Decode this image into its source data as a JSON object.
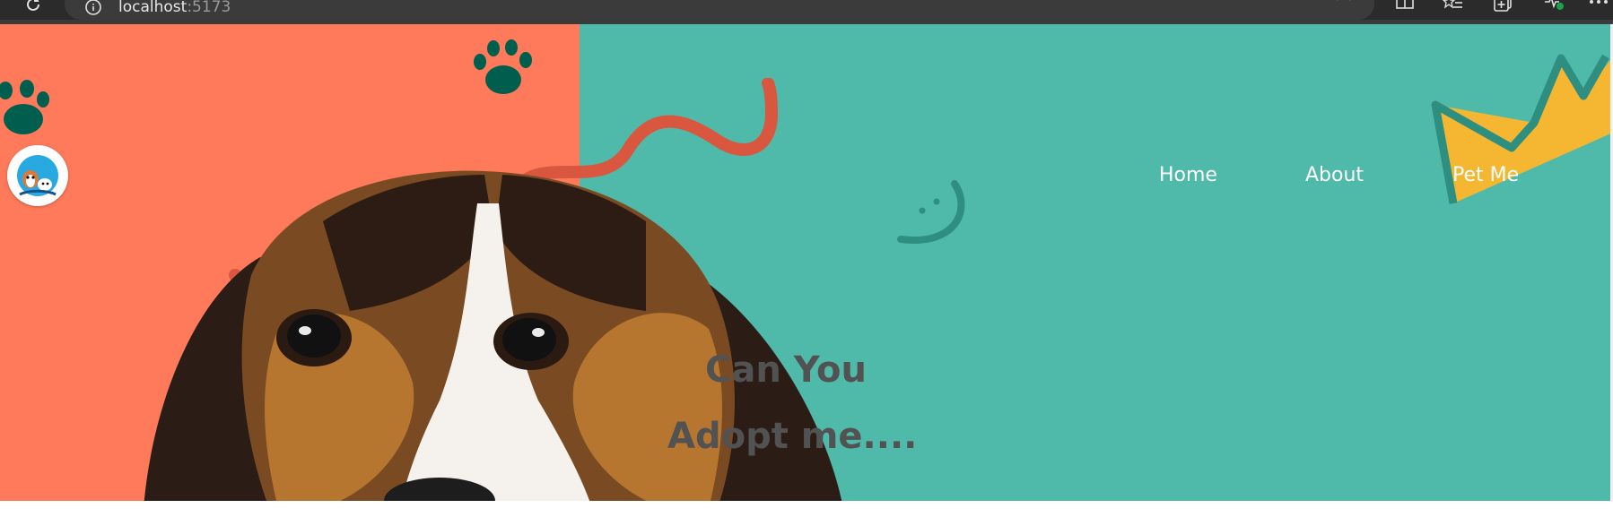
{
  "browser": {
    "url_host": "localhost",
    "url_port": ":5173"
  },
  "nav": {
    "home": "Home",
    "about": "About",
    "pet_me": "Pet Me"
  },
  "hero": {
    "headline_line1": "Can You",
    "headline_line2": "Adopt me....",
    "image": "beagle-puppy-photo"
  },
  "colors": {
    "left_panel": "#ff7a5a",
    "right_panel": "#4fbaa9",
    "paw": "#005e4f",
    "squiggle": "#d9573f",
    "crown": "#f5b731",
    "headline": "#525252"
  },
  "icons": [
    "reload-icon",
    "info-icon",
    "zoom-out-icon",
    "read-aloud-icon",
    "favorite-star-icon",
    "split-screen-icon",
    "favorites-list-icon",
    "collections-icon",
    "browser-health-icon",
    "more-icon",
    "paw-icon",
    "smiley-icon",
    "crown-icon"
  ]
}
